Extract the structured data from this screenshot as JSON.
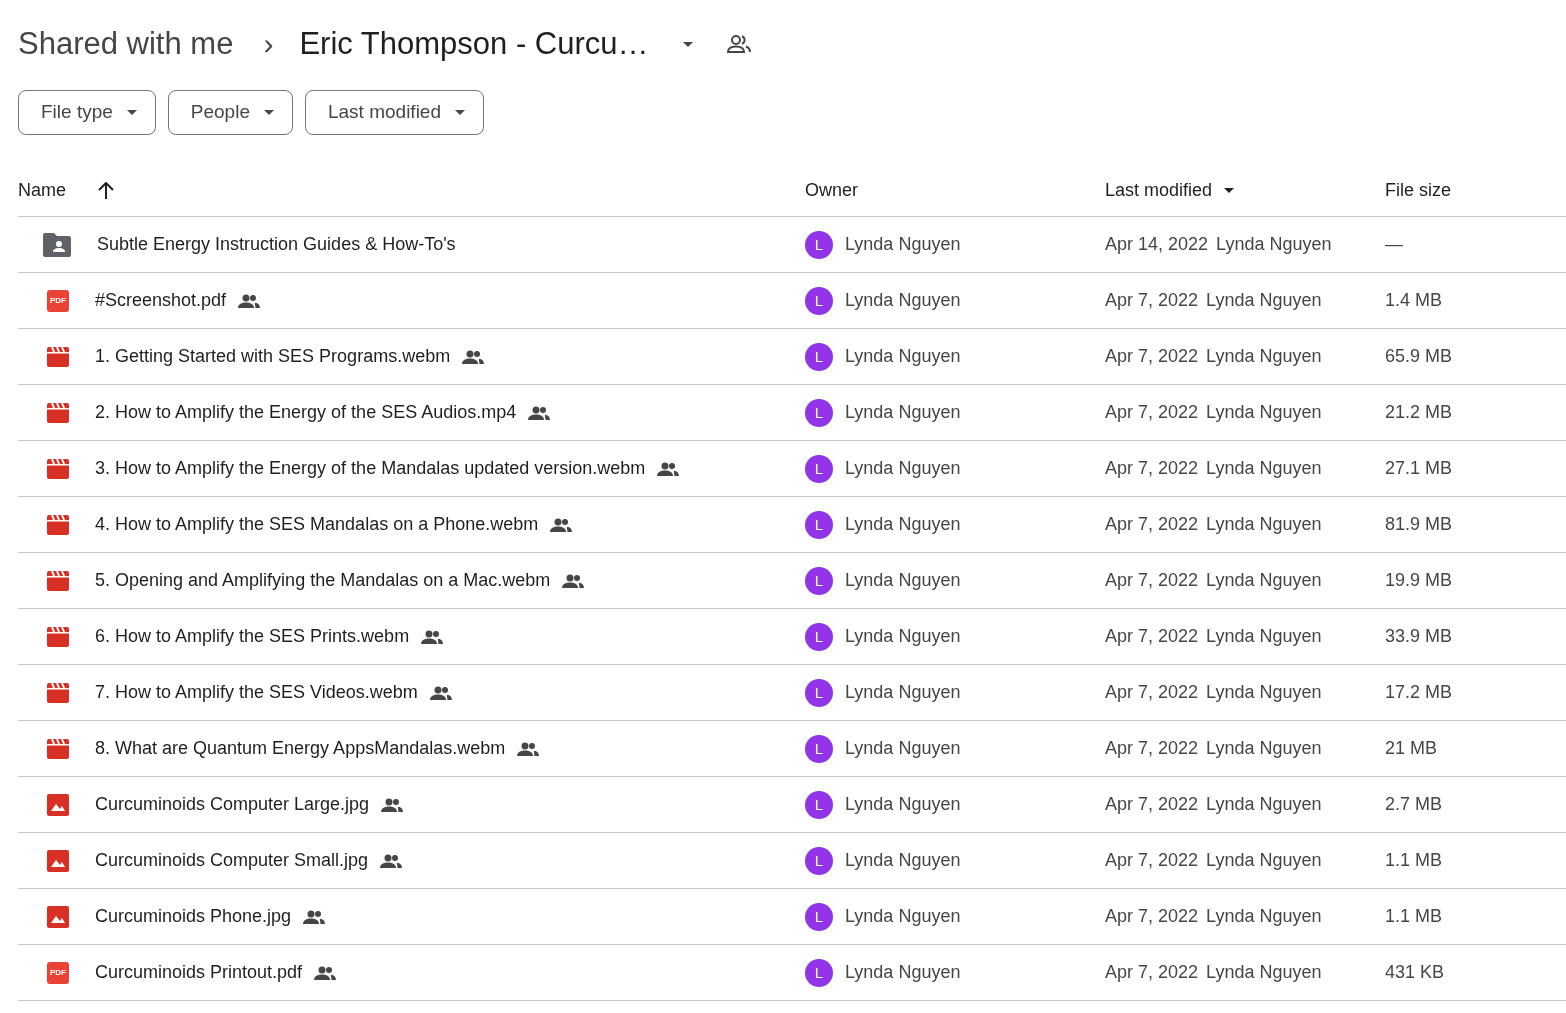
{
  "breadcrumb": {
    "parent": "Shared with me",
    "separator": "›",
    "current": "Eric Thompson - Curcu…"
  },
  "filters": [
    {
      "label": "File type"
    },
    {
      "label": "People"
    },
    {
      "label": "Last modified"
    }
  ],
  "table": {
    "columns": [
      {
        "label": "Name",
        "sorted": true,
        "ascending": true
      },
      {
        "label": "Owner",
        "sorted": false
      },
      {
        "label": "Last modified",
        "sorted": true,
        "ascending": false
      },
      {
        "label": "File size",
        "sorted": false
      }
    ],
    "rows": [
      {
        "kind": "folder",
        "name": "Subtle Energy Instruction Guides & How-To's",
        "shared": false,
        "avatar": "L",
        "owner": "Lynda Nguyen",
        "modified": "Apr 14, 2022",
        "modified_by": "Lynda Nguyen",
        "size": "—"
      },
      {
        "kind": "pdf",
        "icon_label": "PDF",
        "name": "#Screenshot.pdf",
        "shared": true,
        "avatar": "L",
        "owner": "Lynda Nguyen",
        "modified": "Apr 7, 2022",
        "modified_by": "Lynda Nguyen",
        "size": "1.4 MB"
      },
      {
        "kind": "video",
        "name": "1. Getting Started with SES Programs.webm",
        "shared": true,
        "avatar": "L",
        "owner": "Lynda Nguyen",
        "modified": "Apr 7, 2022",
        "modified_by": "Lynda Nguyen",
        "size": "65.9 MB"
      },
      {
        "kind": "video",
        "name": "2. How to Amplify the Energy of the SES Audios.mp4",
        "shared": true,
        "avatar": "L",
        "owner": "Lynda Nguyen",
        "modified": "Apr 7, 2022",
        "modified_by": "Lynda Nguyen",
        "size": "21.2 MB"
      },
      {
        "kind": "video",
        "name": "3. How to Amplify the Energy of the Mandalas updated version.webm",
        "shared": true,
        "avatar": "L",
        "owner": "Lynda Nguyen",
        "modified": "Apr 7, 2022",
        "modified_by": "Lynda Nguyen",
        "size": "27.1 MB"
      },
      {
        "kind": "video",
        "name": "4. How to Amplify the SES Mandalas on a Phone.webm",
        "shared": true,
        "avatar": "L",
        "owner": "Lynda Nguyen",
        "modified": "Apr 7, 2022",
        "modified_by": "Lynda Nguyen",
        "size": "81.9 MB"
      },
      {
        "kind": "video",
        "name": "5. Opening and Amplifying the Mandalas on a Mac.webm",
        "shared": true,
        "avatar": "L",
        "owner": "Lynda Nguyen",
        "modified": "Apr 7, 2022",
        "modified_by": "Lynda Nguyen",
        "size": "19.9 MB"
      },
      {
        "kind": "video",
        "name": "6. How to Amplify the SES Prints.webm",
        "shared": true,
        "avatar": "L",
        "owner": "Lynda Nguyen",
        "modified": "Apr 7, 2022",
        "modified_by": "Lynda Nguyen",
        "size": "33.9 MB"
      },
      {
        "kind": "video",
        "name": "7. How to Amplify the SES Videos.webm",
        "shared": true,
        "avatar": "L",
        "owner": "Lynda Nguyen",
        "modified": "Apr 7, 2022",
        "modified_by": "Lynda Nguyen",
        "size": "17.2 MB"
      },
      {
        "kind": "video",
        "name": "8. What are Quantum Energy AppsMandalas.webm",
        "shared": true,
        "avatar": "L",
        "owner": "Lynda Nguyen",
        "modified": "Apr 7, 2022",
        "modified_by": "Lynda Nguyen",
        "size": "21 MB"
      },
      {
        "kind": "image",
        "name": "Curcuminoids Computer Large.jpg",
        "shared": true,
        "avatar": "L",
        "owner": "Lynda Nguyen",
        "modified": "Apr 7, 2022",
        "modified_by": "Lynda Nguyen",
        "size": "2.7 MB"
      },
      {
        "kind": "image",
        "name": "Curcuminoids Computer Small.jpg",
        "shared": true,
        "avatar": "L",
        "owner": "Lynda Nguyen",
        "modified": "Apr 7, 2022",
        "modified_by": "Lynda Nguyen",
        "size": "1.1 MB"
      },
      {
        "kind": "image",
        "name": "Curcuminoids Phone.jpg",
        "shared": true,
        "avatar": "L",
        "owner": "Lynda Nguyen",
        "modified": "Apr 7, 2022",
        "modified_by": "Lynda Nguyen",
        "size": "1.1 MB"
      },
      {
        "kind": "pdf",
        "icon_label": "PDF",
        "name": "Curcuminoids Printout.pdf",
        "shared": true,
        "avatar": "L",
        "owner": "Lynda Nguyen",
        "modified": "Apr 7, 2022",
        "modified_by": "Lynda Nguyen",
        "size": "431 KB"
      }
    ]
  }
}
